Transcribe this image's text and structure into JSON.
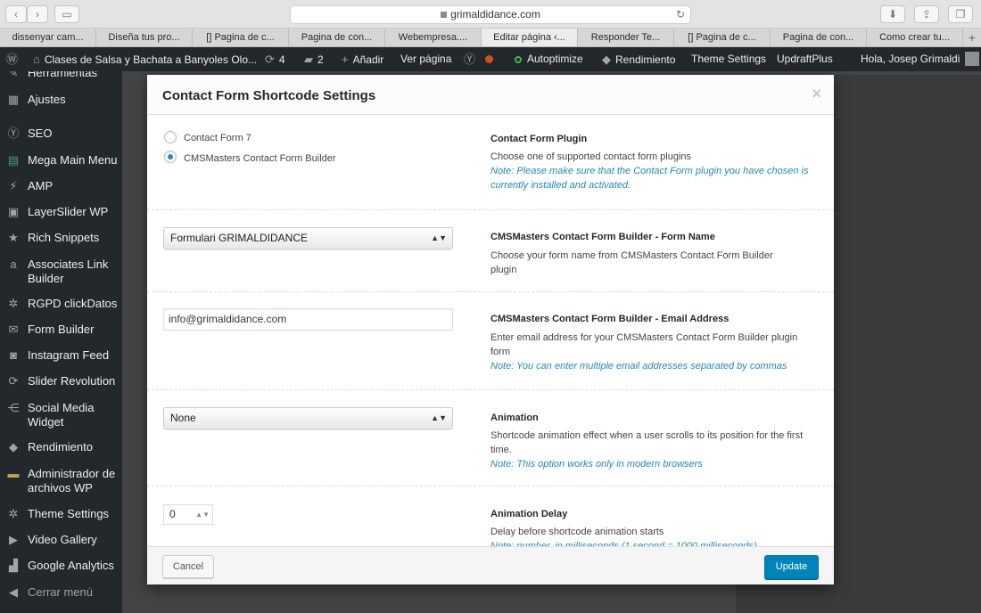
{
  "browser": {
    "url": "grimaldidance.com",
    "tabs": [
      {
        "label": "dissenyar cam..."
      },
      {
        "label": "Diseña tus pro..."
      },
      {
        "label": "[] Pagina de c..."
      },
      {
        "label": "Pagina de con..."
      },
      {
        "label": "Webempresa...."
      },
      {
        "label": "Editar página ‹..."
      },
      {
        "label": "Responder Te..."
      },
      {
        "label": "[] Pagina de c..."
      },
      {
        "label": "Pagina de con..."
      },
      {
        "label": "Como crear tu..."
      }
    ],
    "active_tab_index": 5
  },
  "admin_bar": {
    "site_name": "Clases de Salsa y Bachata a Banyoles Olo...",
    "updates_count": "4",
    "comments_count": "2",
    "new_label": "Añadir",
    "view_page": "Ver página",
    "autoptimize": "Autoptimize",
    "rendimiento": "Rendimiento",
    "theme_settings": "Theme Settings",
    "updraftplus": "UpdraftPlus",
    "greeting": "Hola, Josep Grimaldi"
  },
  "sidebar": {
    "items": [
      {
        "label": "Herramientas",
        "icon": "wrench-icon"
      },
      {
        "label": "Ajustes",
        "icon": "settings-icon"
      },
      {
        "label": "SEO",
        "icon": "seo-icon"
      },
      {
        "label": "Mega Main Menu",
        "icon": "menu-icon"
      },
      {
        "label": "AMP",
        "icon": "amp-icon"
      },
      {
        "label": "LayerSlider WP",
        "icon": "layers-icon"
      },
      {
        "label": "Rich Snippets",
        "icon": "star-icon"
      },
      {
        "label": "Associates Link Builder",
        "icon": "amazon-icon"
      },
      {
        "label": "RGPD clickDatos",
        "icon": "gear-icon"
      },
      {
        "label": "Form Builder",
        "icon": "mail-icon"
      },
      {
        "label": "Instagram Feed",
        "icon": "camera-icon"
      },
      {
        "label": "Slider Revolution",
        "icon": "refresh-icon"
      },
      {
        "label": "Social Media Widget",
        "icon": "share-icon"
      },
      {
        "label": "Rendimiento",
        "icon": "cube-icon"
      },
      {
        "label": "Administrador de archivos WP",
        "icon": "folder-icon"
      },
      {
        "label": "Theme Settings",
        "icon": "gear-icon"
      },
      {
        "label": "Video Gallery",
        "icon": "video-icon"
      },
      {
        "label": "Google Analytics",
        "icon": "chart-icon"
      },
      {
        "label": "Cerrar menú",
        "icon": "collapse-icon"
      }
    ]
  },
  "modal": {
    "title": "Contact Form Shortcode Settings",
    "plugin": {
      "options": [
        "Contact Form 7",
        "CMSMasters Contact Form Builder"
      ],
      "selected": "CMSMasters Contact Form Builder",
      "label": "Contact Form Plugin",
      "desc": "Choose one of supported contact form plugins",
      "note": "Note: Please make sure that the Contact Form plugin you have chosen is currently installed and activated."
    },
    "form_name": {
      "value": "Formulari GRIMALDIDANCE",
      "label": "CMSMasters Contact Form Builder - Form Name",
      "desc": "Choose your form name from CMSMasters Contact Form Builder plugin"
    },
    "email": {
      "value": "info@grimaldidance.com",
      "label": "CMSMasters Contact Form Builder - Email Address",
      "desc": "Enter email address for your CMSMasters Contact Form Builder plugin form",
      "note": "Note: You can enter multiple email addresses separated by commas"
    },
    "animation": {
      "value": "None",
      "label": "Animation",
      "desc": "Shortcode animation effect when a user scrolls to its position for the first time.",
      "note": "Note: This option works only in modern browsers"
    },
    "delay": {
      "value": "0",
      "label": "Animation Delay",
      "desc": "Delay before shortcode animation starts",
      "note": "Note: number, in milliseconds (1 second = 1000 milliseconds)"
    },
    "cancel_label": "Cancel",
    "update_label": "Update"
  }
}
